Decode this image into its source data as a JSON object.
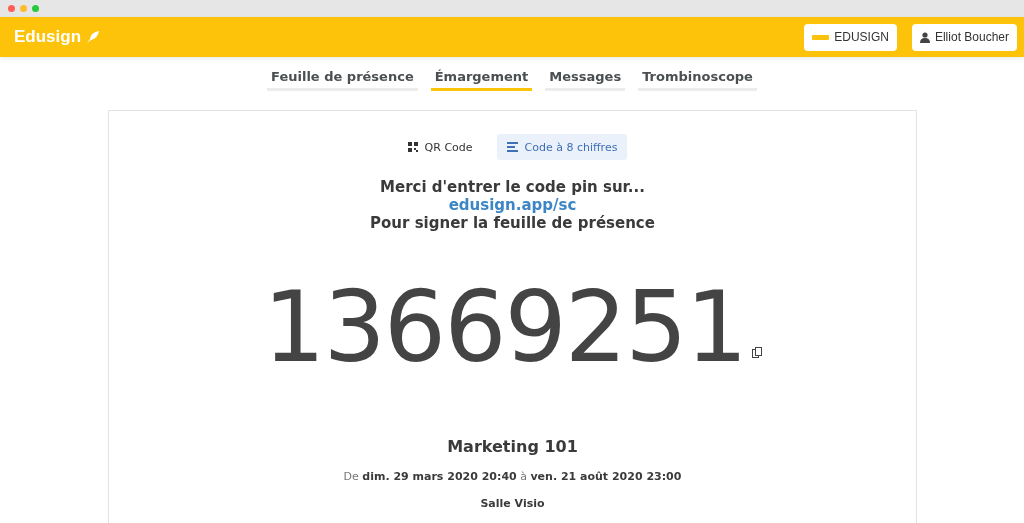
{
  "header": {
    "logo": "Edusign",
    "buttons": [
      {
        "kind": "org",
        "label": "EDUSIGN"
      },
      {
        "kind": "user",
        "label": "Elliot Boucher"
      }
    ]
  },
  "tabs": [
    {
      "label": "Feuille de présence",
      "selected": false
    },
    {
      "label": "Émargement",
      "selected": true
    },
    {
      "label": "Messages",
      "selected": false
    },
    {
      "label": "Trombinoscope",
      "selected": false
    }
  ],
  "modes": [
    {
      "kind": "qr",
      "label": "QR Code",
      "selected": false
    },
    {
      "kind": "digits",
      "label": "Code à 8 chiffres",
      "selected": true
    }
  ],
  "instructions": {
    "line_1": "Merci d'entrer le code pin sur...",
    "link": "edusign.app/sc",
    "line_2": "Pour signer la feuille de présence"
  },
  "pin_code": "13669251",
  "course": {
    "title": "Marketing 101",
    "dates": "De **dim. 29 mars 2020 20:40** à **ven. 21 août 2020 23:00**",
    "room": "Salle Visio"
  }
}
